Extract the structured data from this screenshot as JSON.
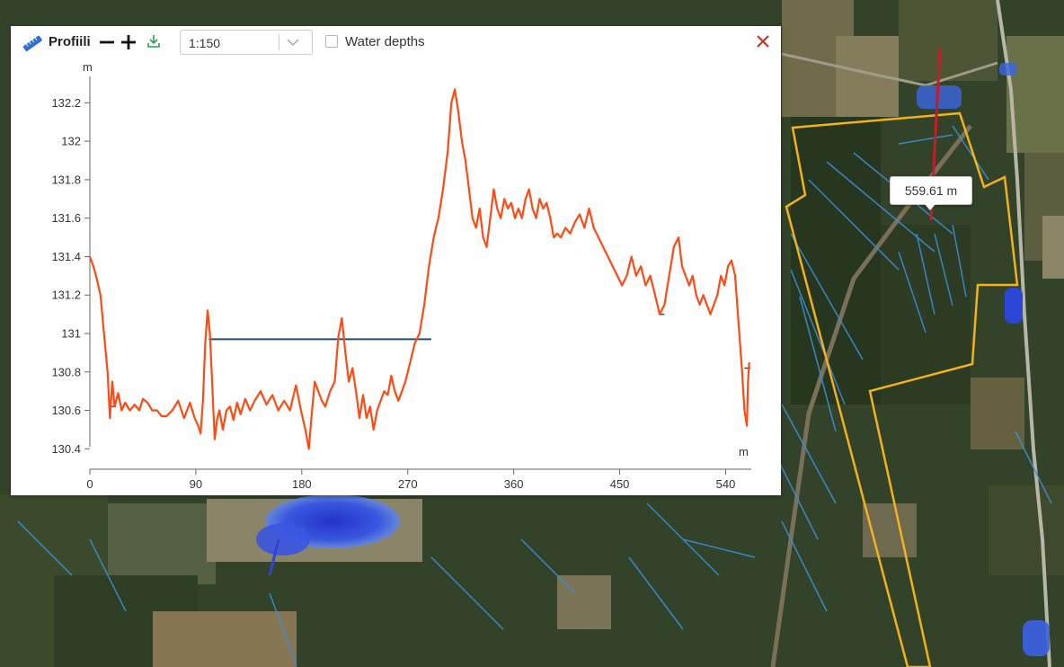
{
  "panel": {
    "title": "Profiili",
    "scale": {
      "selected": "1:150"
    },
    "water_depths_label": "Water depths",
    "water_depths_checked": false
  },
  "tooltip": {
    "distance_label": "559.61 m"
  },
  "colors": {
    "profile_line": "#ff4a14",
    "water_level": "#1f4e79",
    "close": "#c0392b",
    "download": "#2e9e4f",
    "ruler": "#2f6fd6",
    "measure_line": "#c41d2a",
    "parcel_outline": "#f2b21b",
    "ditch": "#3a8fd9",
    "water_pool": "#2942d6"
  },
  "chart_data": {
    "type": "line",
    "xlabel": "m",
    "ylabel": "m",
    "xlim": [
      0,
      561
    ],
    "ylim": [
      130.35,
      132.3
    ],
    "x_ticks": [
      0,
      90,
      180,
      270,
      360,
      450,
      540
    ],
    "y_ticks": [
      130.4,
      130.6,
      130.8,
      131,
      131.2,
      131.4,
      131.6,
      131.8,
      132,
      132.2
    ],
    "y_tick_labels": [
      "130.4",
      "130.6",
      "130.8",
      "131",
      "131.2",
      "131.4",
      "131.6",
      "131.8",
      "132",
      "132.2"
    ],
    "series": [
      {
        "values": [
          [
            0,
            131.4
          ],
          [
            3,
            131.35
          ],
          [
            6,
            131.28
          ],
          [
            9,
            131.2
          ],
          [
            12,
            131.0
          ],
          [
            15,
            130.8
          ],
          [
            17,
            130.56
          ],
          [
            19,
            130.75
          ],
          [
            21,
            130.62
          ],
          [
            24,
            130.69
          ],
          [
            27,
            130.6
          ],
          [
            30,
            130.64
          ],
          [
            34,
            130.6
          ],
          [
            38,
            130.63
          ],
          [
            42,
            130.6
          ],
          [
            45,
            130.66
          ],
          [
            49,
            130.64
          ],
          [
            53,
            130.6
          ],
          [
            57,
            130.6
          ],
          [
            61,
            130.57
          ],
          [
            65,
            130.57
          ],
          [
            70,
            130.6
          ],
          [
            75,
            130.65
          ],
          [
            80,
            130.56
          ],
          [
            85,
            130.64
          ],
          [
            89,
            130.56
          ],
          [
            92,
            130.52
          ],
          [
            94,
            130.48
          ],
          [
            96,
            130.65
          ],
          [
            98,
            130.95
          ],
          [
            100,
            131.12
          ],
          [
            102,
            131.0
          ],
          [
            104,
            130.72
          ],
          [
            106,
            130.45
          ],
          [
            108,
            130.55
          ],
          [
            110,
            130.6
          ],
          [
            113,
            130.5
          ],
          [
            116,
            130.6
          ],
          [
            119,
            130.62
          ],
          [
            122,
            130.55
          ],
          [
            125,
            130.64
          ],
          [
            128,
            130.58
          ],
          [
            132,
            130.66
          ],
          [
            136,
            130.6
          ],
          [
            140,
            130.65
          ],
          [
            145,
            130.7
          ],
          [
            150,
            130.63
          ],
          [
            155,
            130.68
          ],
          [
            160,
            130.6
          ],
          [
            165,
            130.65
          ],
          [
            170,
            130.6
          ],
          [
            175,
            130.73
          ],
          [
            180,
            130.58
          ],
          [
            183,
            130.5
          ],
          [
            186,
            130.4
          ],
          [
            188,
            130.55
          ],
          [
            191,
            130.75
          ],
          [
            194,
            130.7
          ],
          [
            197,
            130.65
          ],
          [
            200,
            130.62
          ],
          [
            204,
            130.7
          ],
          [
            208,
            130.75
          ],
          [
            211,
            130.98
          ],
          [
            214,
            131.08
          ],
          [
            217,
            130.9
          ],
          [
            220,
            130.75
          ],
          [
            223,
            130.82
          ],
          [
            226,
            130.7
          ],
          [
            229,
            130.56
          ],
          [
            232,
            130.68
          ],
          [
            235,
            130.56
          ],
          [
            238,
            130.62
          ],
          [
            241,
            130.5
          ],
          [
            244,
            130.6
          ],
          [
            247,
            130.65
          ],
          [
            250,
            130.7
          ],
          [
            253,
            130.68
          ],
          [
            256,
            130.78
          ],
          [
            259,
            130.7
          ],
          [
            262,
            130.65
          ],
          [
            265,
            130.7
          ],
          [
            268,
            130.75
          ],
          [
            272,
            130.85
          ],
          [
            276,
            130.95
          ],
          [
            280,
            131.0
          ],
          [
            284,
            131.15
          ],
          [
            288,
            131.35
          ],
          [
            292,
            131.5
          ],
          [
            296,
            131.6
          ],
          [
            300,
            131.75
          ],
          [
            304,
            131.95
          ],
          [
            307,
            132.2
          ],
          [
            310,
            132.27
          ],
          [
            313,
            132.15
          ],
          [
            316,
            132.0
          ],
          [
            319,
            131.9
          ],
          [
            322,
            131.75
          ],
          [
            325,
            131.6
          ],
          [
            328,
            131.55
          ],
          [
            331,
            131.65
          ],
          [
            334,
            131.5
          ],
          [
            337,
            131.45
          ],
          [
            340,
            131.6
          ],
          [
            343,
            131.75
          ],
          [
            346,
            131.65
          ],
          [
            349,
            131.6
          ],
          [
            352,
            131.7
          ],
          [
            355,
            131.65
          ],
          [
            358,
            131.68
          ],
          [
            361,
            131.6
          ],
          [
            364,
            131.65
          ],
          [
            367,
            131.6
          ],
          [
            370,
            131.7
          ],
          [
            373,
            131.75
          ],
          [
            376,
            131.65
          ],
          [
            379,
            131.6
          ],
          [
            382,
            131.7
          ],
          [
            385,
            131.65
          ],
          [
            388,
            131.68
          ],
          [
            391,
            131.6
          ],
          [
            394,
            131.5
          ],
          [
            397,
            131.52
          ],
          [
            400,
            131.5
          ],
          [
            404,
            131.55
          ],
          [
            408,
            131.52
          ],
          [
            412,
            131.58
          ],
          [
            416,
            131.62
          ],
          [
            420,
            131.55
          ],
          [
            424,
            131.65
          ],
          [
            428,
            131.55
          ],
          [
            432,
            131.5
          ],
          [
            436,
            131.45
          ],
          [
            440,
            131.4
          ],
          [
            444,
            131.35
          ],
          [
            448,
            131.3
          ],
          [
            452,
            131.25
          ],
          [
            456,
            131.3
          ],
          [
            460,
            131.4
          ],
          [
            464,
            131.3
          ],
          [
            468,
            131.35
          ],
          [
            472,
            131.25
          ],
          [
            476,
            131.3
          ],
          [
            480,
            131.2
          ],
          [
            484,
            131.1
          ],
          [
            488,
            131.15
          ],
          [
            492,
            131.3
          ],
          [
            496,
            131.45
          ],
          [
            500,
            131.5
          ],
          [
            503,
            131.35
          ],
          [
            506,
            131.3
          ],
          [
            509,
            131.25
          ],
          [
            512,
            131.3
          ],
          [
            515,
            131.2
          ],
          [
            518,
            131.15
          ],
          [
            521,
            131.2
          ],
          [
            524,
            131.15
          ],
          [
            527,
            131.1
          ],
          [
            530,
            131.15
          ],
          [
            533,
            131.2
          ],
          [
            536,
            131.3
          ],
          [
            539,
            131.25
          ],
          [
            542,
            131.35
          ],
          [
            545,
            131.38
          ],
          [
            548,
            131.3
          ],
          [
            551,
            131.05
          ],
          [
            554,
            130.8
          ],
          [
            556,
            130.6
          ],
          [
            558,
            130.52
          ],
          [
            559,
            130.75
          ],
          [
            560,
            130.85
          ]
        ]
      },
      {
        "values": [
          [
            101,
            130.97
          ],
          [
            290,
            130.97
          ]
        ]
      }
    ]
  }
}
